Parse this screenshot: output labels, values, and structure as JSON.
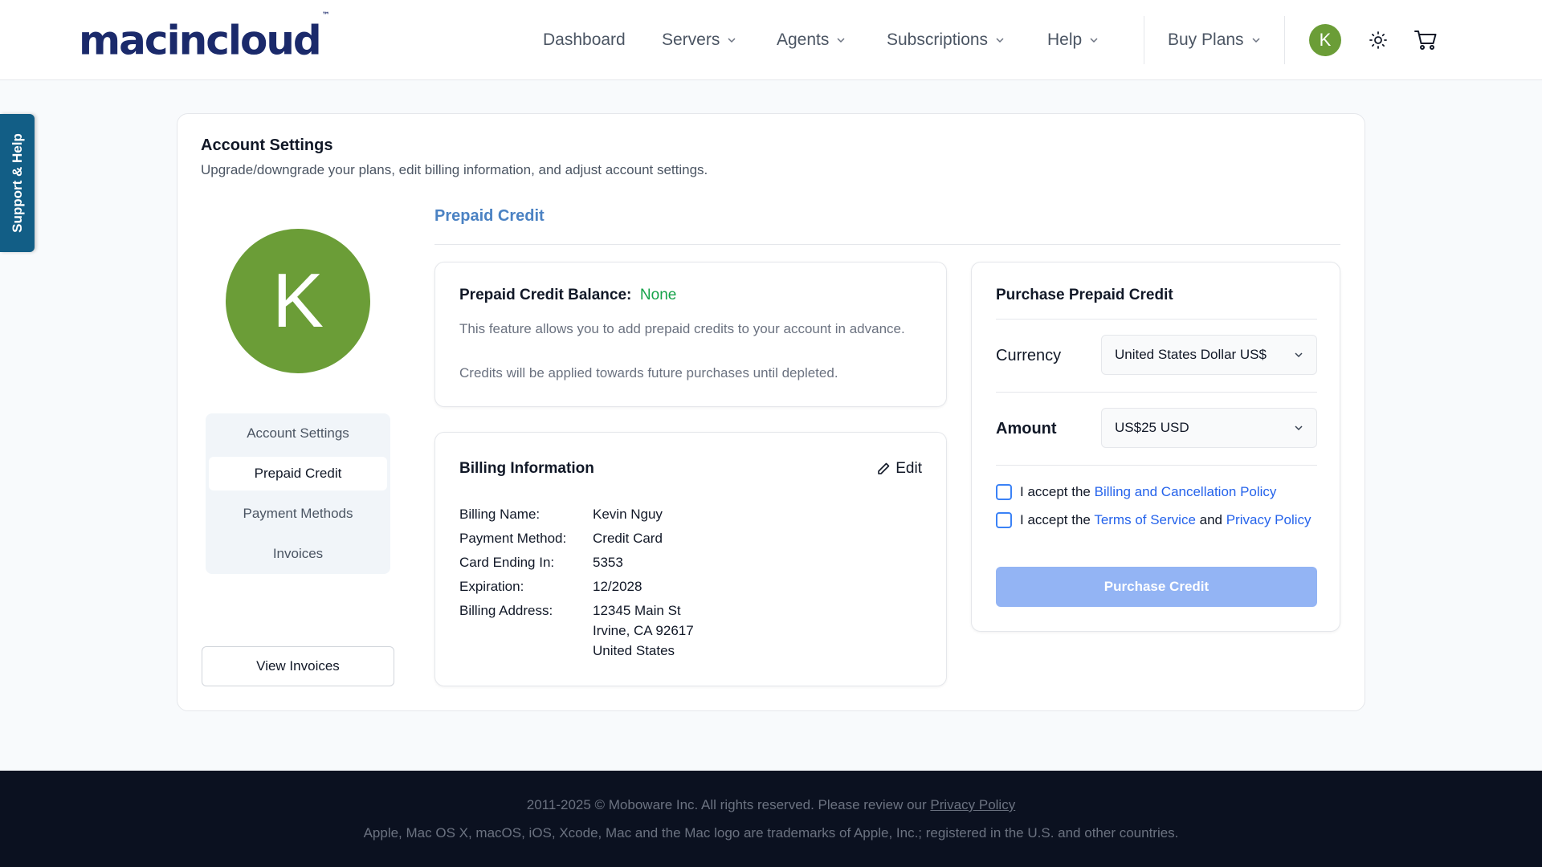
{
  "header": {
    "logo_text": "macincloud",
    "logo_tm": "™",
    "nav": [
      {
        "label": "Dashboard",
        "has_dropdown": false
      },
      {
        "label": "Servers",
        "has_dropdown": true
      },
      {
        "label": "Agents",
        "has_dropdown": true
      },
      {
        "label": "Subscriptions",
        "has_dropdown": true
      },
      {
        "label": "Help",
        "has_dropdown": true
      }
    ],
    "buy_plans": "Buy Plans",
    "user_initial": "K",
    "icons": {
      "theme": "sun-icon",
      "cart": "cart-icon"
    },
    "avatar_color": "#6b9d37"
  },
  "support_tab": "Support & Help",
  "page": {
    "title": "Account Settings",
    "subtitle": "Upgrade/downgrade your plans, edit billing information, and adjust account settings.",
    "avatar_initial": "K",
    "side_menu": [
      {
        "label": "Account Settings",
        "active": false
      },
      {
        "label": "Prepaid Credit",
        "active": true
      },
      {
        "label": "Payment Methods",
        "active": false
      },
      {
        "label": "Invoices",
        "active": false
      }
    ],
    "view_invoices": "View Invoices",
    "section_heading": "Prepaid Credit"
  },
  "balance": {
    "title": "Prepaid Credit Balance:",
    "value": "None",
    "desc1": "This feature allows you to add prepaid credits to your account in advance.",
    "desc2": "Credits will be applied towards future purchases until depleted."
  },
  "billing": {
    "title": "Billing Information",
    "edit_label": "Edit",
    "fields": [
      {
        "label": "Billing Name:",
        "value": "Kevin Nguy"
      },
      {
        "label": "Payment Method:",
        "value": "Credit Card"
      },
      {
        "label": "Card Ending In:",
        "value": "5353"
      },
      {
        "label": "Expiration:",
        "value": "12/2028"
      },
      {
        "label": "Billing Address:",
        "value": "12345 Main St"
      }
    ],
    "address_line2": "Irvine, CA 92617",
    "address_line3": "United States"
  },
  "purchase": {
    "title": "Purchase Prepaid Credit",
    "currency_label": "Currency",
    "currency_value": "United States Dollar US$",
    "amount_label": "Amount",
    "amount_value": "US$25 USD",
    "accept1_prefix": "I accept the ",
    "accept1_link": "Billing and Cancellation Policy",
    "accept2_prefix": "I accept the ",
    "accept2_link1": "Terms of Service",
    "accept2_mid": " and ",
    "accept2_link2": "Privacy Policy",
    "button": "Purchase Credit",
    "accent_color": "#2563eb"
  },
  "footer": {
    "line1_prefix": "2011-2025 © Moboware Inc. All rights reserved. Please review our ",
    "line1_link": "Privacy Policy",
    "line2": "Apple, Mac OS X, macOS, iOS, Xcode, Mac and the Mac logo are trademarks of Apple, Inc.; registered in the U.S. and other countries."
  }
}
